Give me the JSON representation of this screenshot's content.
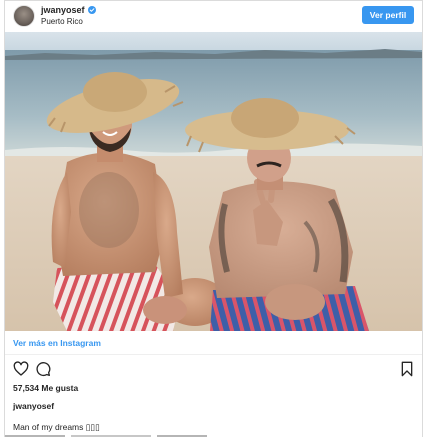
{
  "header": {
    "username": "jwanyosef",
    "location": "Puerto Rico",
    "view_profile_label": "Ver perfil"
  },
  "icons": {
    "verified": "verified-badge-icon",
    "like": "heart-icon",
    "comment": "comment-icon",
    "save": "bookmark-icon"
  },
  "post": {
    "view_more_label": "Ver más en Instagram",
    "likes_text": "57,534 Me gusta",
    "caption_username": "jwanyosef",
    "caption_text": "Man of my dreams ▯▯▯"
  },
  "colors": {
    "accent": "#3897f0",
    "verified": "#3897f0",
    "text": "#262626",
    "border": "#dbdbdb"
  }
}
